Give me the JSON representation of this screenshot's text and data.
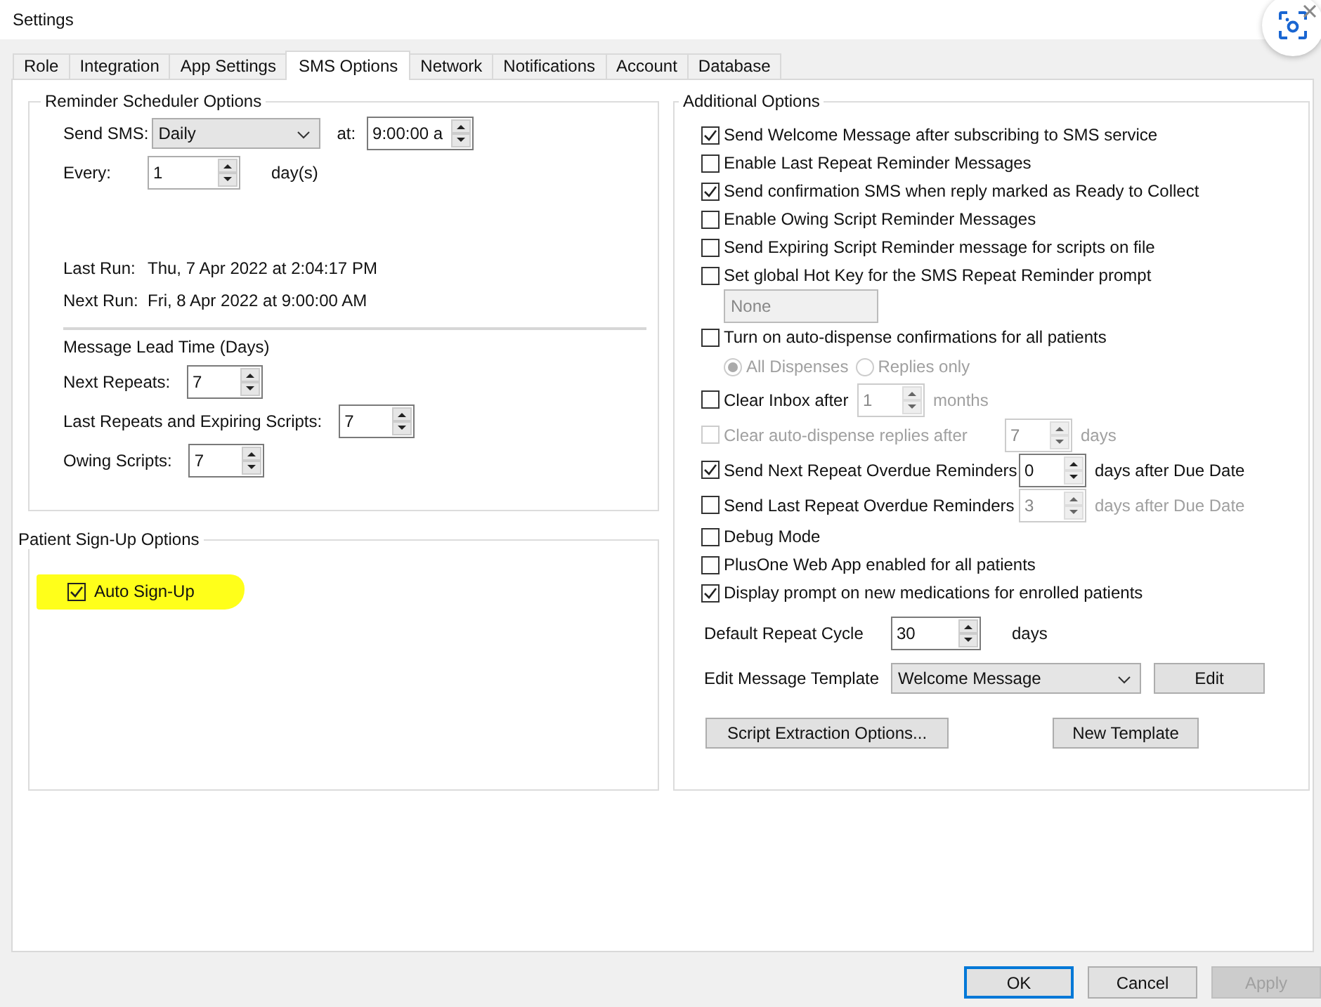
{
  "window": {
    "title": "Settings"
  },
  "tabs": [
    {
      "label": "Role",
      "selected": false
    },
    {
      "label": "Integration",
      "selected": false
    },
    {
      "label": "App Settings",
      "selected": false
    },
    {
      "label": "SMS Options",
      "selected": true
    },
    {
      "label": "Network",
      "selected": false
    },
    {
      "label": "Notifications",
      "selected": false
    },
    {
      "label": "Account",
      "selected": false
    },
    {
      "label": "Database",
      "selected": false
    }
  ],
  "reminder_scheduler": {
    "title": "Reminder Scheduler Options",
    "send_sms_label": "Send SMS:",
    "send_sms_value": "Daily",
    "at_label": "at:",
    "at_value": "9:00:00 a",
    "every_label": "Every:",
    "every_value": "1",
    "every_unit": "day(s)",
    "last_run_label": "Last Run:",
    "last_run_value": "Thu, 7 Apr 2022 at 2:04:17 PM",
    "next_run_label": "Next Run:",
    "next_run_value": "Fri, 8 Apr 2022 at 9:00:00 AM",
    "lead_time_title": "Message Lead Time (Days)",
    "lead_fields": [
      {
        "label": "Next Repeats:",
        "value": "7"
      },
      {
        "label": "Last Repeats and Expiring Scripts:",
        "value": "7"
      },
      {
        "label": "Owing Scripts:",
        "value": "7"
      }
    ]
  },
  "patient_signup": {
    "title": "Patient Sign-Up Options",
    "auto_signup": {
      "label": "Auto Sign-Up",
      "checked": true,
      "highlighted": true
    }
  },
  "additional_options": {
    "title": "Additional Options",
    "items": [
      {
        "kind": "checkbox",
        "label": "Send Welcome Message after subscribing to SMS service",
        "checked": true,
        "disabled": false
      },
      {
        "kind": "checkbox",
        "label": "Enable Last Repeat Reminder Messages",
        "checked": false,
        "disabled": false
      },
      {
        "kind": "checkbox",
        "label": "Send confirmation SMS when reply marked as Ready to Collect",
        "checked": true,
        "disabled": false
      },
      {
        "kind": "checkbox",
        "label": "Enable Owing Script Reminder Messages",
        "checked": false,
        "disabled": false
      },
      {
        "kind": "checkbox",
        "label": "Send Expiring Script Reminder message for scripts on file",
        "checked": false,
        "disabled": false
      },
      {
        "kind": "checkbox",
        "label": "Set global Hot Key for the SMS Repeat Reminder prompt",
        "checked": false,
        "disabled": false
      },
      {
        "kind": "field",
        "value": "None",
        "disabled": true
      },
      {
        "kind": "checkbox",
        "label": "Turn on auto-dispense confirmations for all patients",
        "checked": false,
        "disabled": false
      },
      {
        "kind": "radios",
        "disabled": true,
        "options": [
          {
            "label": "All Dispenses",
            "selected": true
          },
          {
            "label": "Replies only",
            "selected": false
          }
        ]
      },
      {
        "kind": "checkbox_spin",
        "label": "Clear Inbox after",
        "checked": false,
        "disabled": false,
        "spin": {
          "value": "1",
          "unit": "months",
          "disabled": true
        }
      },
      {
        "kind": "checkbox_spin",
        "label": "Clear auto-dispense replies after",
        "checked": false,
        "disabled": true,
        "spin": {
          "value": "7",
          "unit": "days",
          "disabled": true
        }
      },
      {
        "kind": "checkbox_spin",
        "label": "Send Next Repeat Overdue Reminders",
        "checked": true,
        "disabled": false,
        "spin": {
          "value": "0",
          "unit": "days after Due Date",
          "disabled": false
        }
      },
      {
        "kind": "checkbox_spin",
        "label": "Send Last Repeat Overdue Reminders",
        "checked": false,
        "disabled": false,
        "spin": {
          "value": "3",
          "unit": "days after Due Date",
          "disabled": true
        }
      },
      {
        "kind": "checkbox",
        "label": "Debug Mode",
        "checked": false,
        "disabled": false
      },
      {
        "kind": "checkbox",
        "label": "PlusOne Web App enabled for all patients",
        "checked": false,
        "disabled": false
      },
      {
        "kind": "checkbox",
        "label": "Display prompt on new medications for enrolled patients",
        "checked": true,
        "disabled": false
      }
    ],
    "default_repeat_cycle": {
      "label": "Default Repeat Cycle",
      "value": "30",
      "unit": "days"
    },
    "edit_template": {
      "label": "Edit Message Template",
      "value": "Welcome Message",
      "button": "Edit"
    },
    "buttons": [
      "Script Extraction Options...",
      "New Template"
    ]
  },
  "footer_buttons": [
    {
      "label": "OK",
      "focused": true,
      "disabled": false
    },
    {
      "label": "Cancel",
      "focused": false,
      "disabled": false
    },
    {
      "label": "Apply",
      "focused": false,
      "disabled": true
    }
  ]
}
